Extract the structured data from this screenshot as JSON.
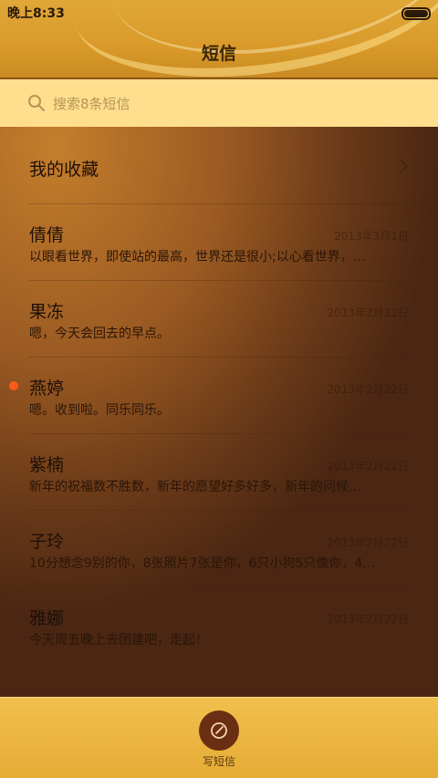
{
  "status_bar": {
    "time": "晚上8:33"
  },
  "header": {
    "title": "短信"
  },
  "search": {
    "placeholder": "搜索8条短信"
  },
  "favorites": {
    "label": "我的收藏"
  },
  "messages": [
    {
      "name": "倩倩",
      "date": "2013年3月1日",
      "preview": "以眼看世界，即使站的最高，世界还是很小;以心看世界，…",
      "unread": false
    },
    {
      "name": "果冻",
      "date": "2013年2月22日",
      "preview": "嗯，今天会回去的早点。",
      "unread": false
    },
    {
      "name": "燕婷",
      "date": "2013年2月22日",
      "preview": "嗯。收到啦。同乐同乐。",
      "unread": true
    },
    {
      "name": "紫楠",
      "date": "2013年2月22日",
      "preview": "新年的祝福数不胜数，新年的愿望好多好多，新年的问候…",
      "unread": false
    },
    {
      "name": "子玲",
      "date": "2013年2月22日",
      "preview": "10分想念9别的你，8张照片7张是你，6只小狗5只像你，4…",
      "unread": false
    },
    {
      "name": "雅娜",
      "date": "2013年2月22日",
      "preview": "今天周五晚上去团建吧，走起！",
      "unread": false
    }
  ],
  "bottom_bar": {
    "compose_label": "写短信"
  },
  "colors": {
    "accent": "#e0a738",
    "unread_dot": "#ff5a1a",
    "compose_button": "#6a2e12"
  }
}
